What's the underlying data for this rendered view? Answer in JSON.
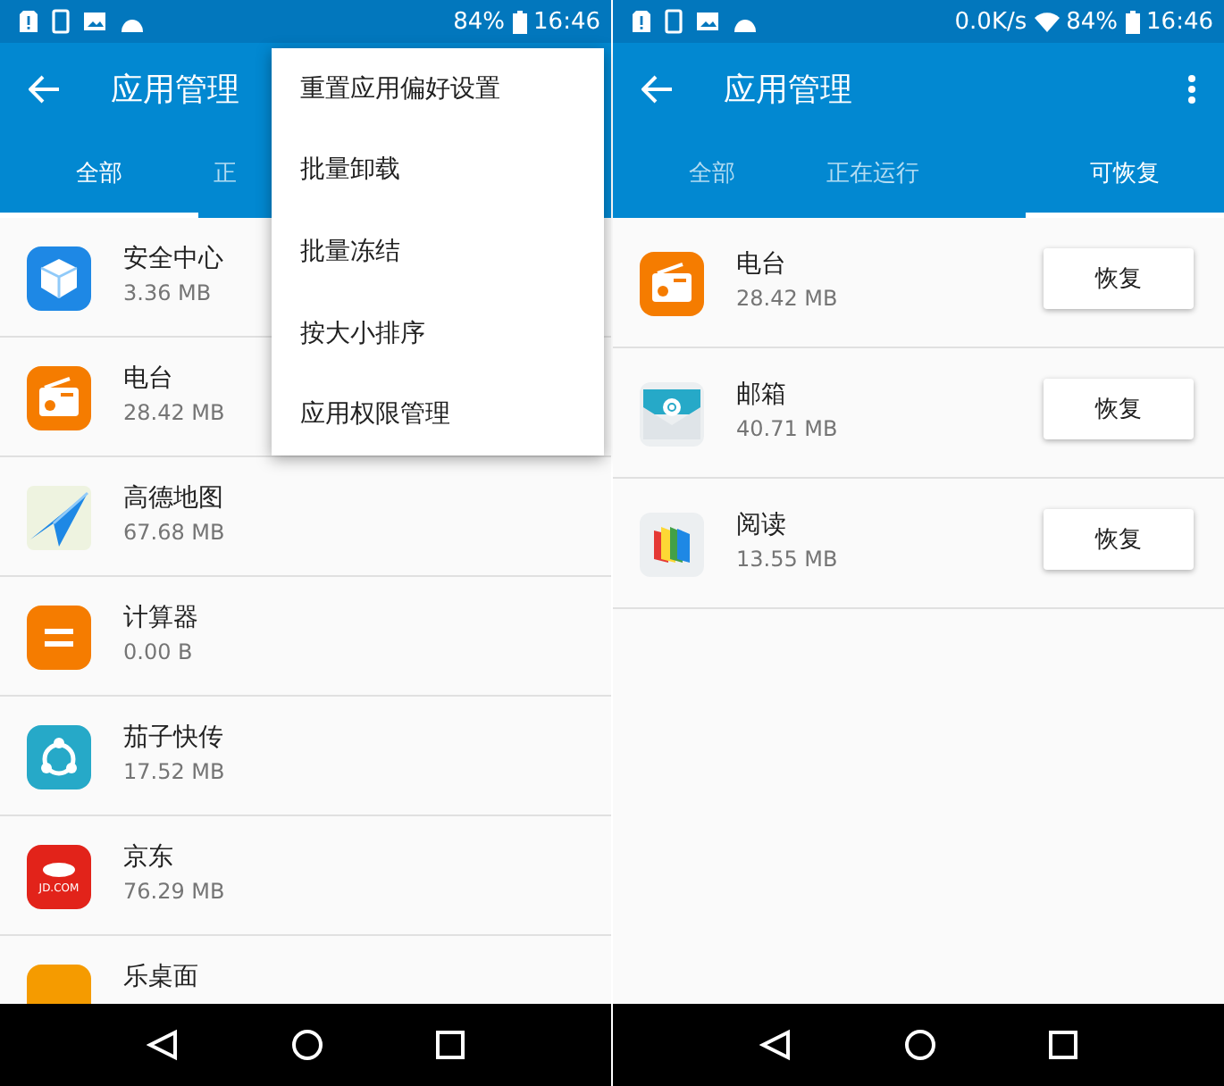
{
  "screens": [
    {
      "status_bar": {
        "battery": "84%",
        "time": "16:46"
      },
      "toolbar": {
        "title": "应用管理"
      },
      "tabs": [
        {
          "label": "全部",
          "selected": true
        },
        {
          "label": "正",
          "selected": false
        }
      ],
      "menu": [
        "重置应用偏好设置",
        "批量卸载",
        "批量冻结",
        "按大小排序",
        "应用权限管理"
      ],
      "apps": [
        {
          "kind": "cube",
          "name": "安全中心",
          "size": "3.36 MB"
        },
        {
          "kind": "radio",
          "name": "电台",
          "size": "28.42 MB"
        },
        {
          "kind": "map",
          "name": "高德地图",
          "size": "67.68 MB"
        },
        {
          "kind": "calculator",
          "name": "计算器",
          "size": "0.00 B"
        },
        {
          "kind": "share",
          "name": "茄子快传",
          "size": "17.52 MB"
        },
        {
          "kind": "mascot",
          "name": "京东",
          "size": "76.29 MB",
          "logo_text": "JD.COM"
        },
        {
          "kind": "launcher",
          "name": "乐桌面"
        }
      ]
    },
    {
      "status_bar": {
        "speed": "0.0K/s",
        "wifi": true,
        "battery": "84%",
        "time": "16:46"
      },
      "toolbar": {
        "title": "应用管理",
        "overflow_menu": true
      },
      "tabs": [
        {
          "label": "全部",
          "selected": false
        },
        {
          "label": "正在运行",
          "selected": false
        },
        {
          "label": "可恢复",
          "selected": true
        }
      ],
      "apps": [
        {
          "kind": "radio",
          "name": "电台",
          "size": "28.42 MB",
          "button": "恢复"
        },
        {
          "kind": "mail",
          "name": "邮箱",
          "size": "40.71 MB",
          "button": "恢复"
        },
        {
          "kind": "book",
          "name": "阅读",
          "size": "13.55 MB",
          "button": "恢复"
        }
      ]
    }
  ]
}
